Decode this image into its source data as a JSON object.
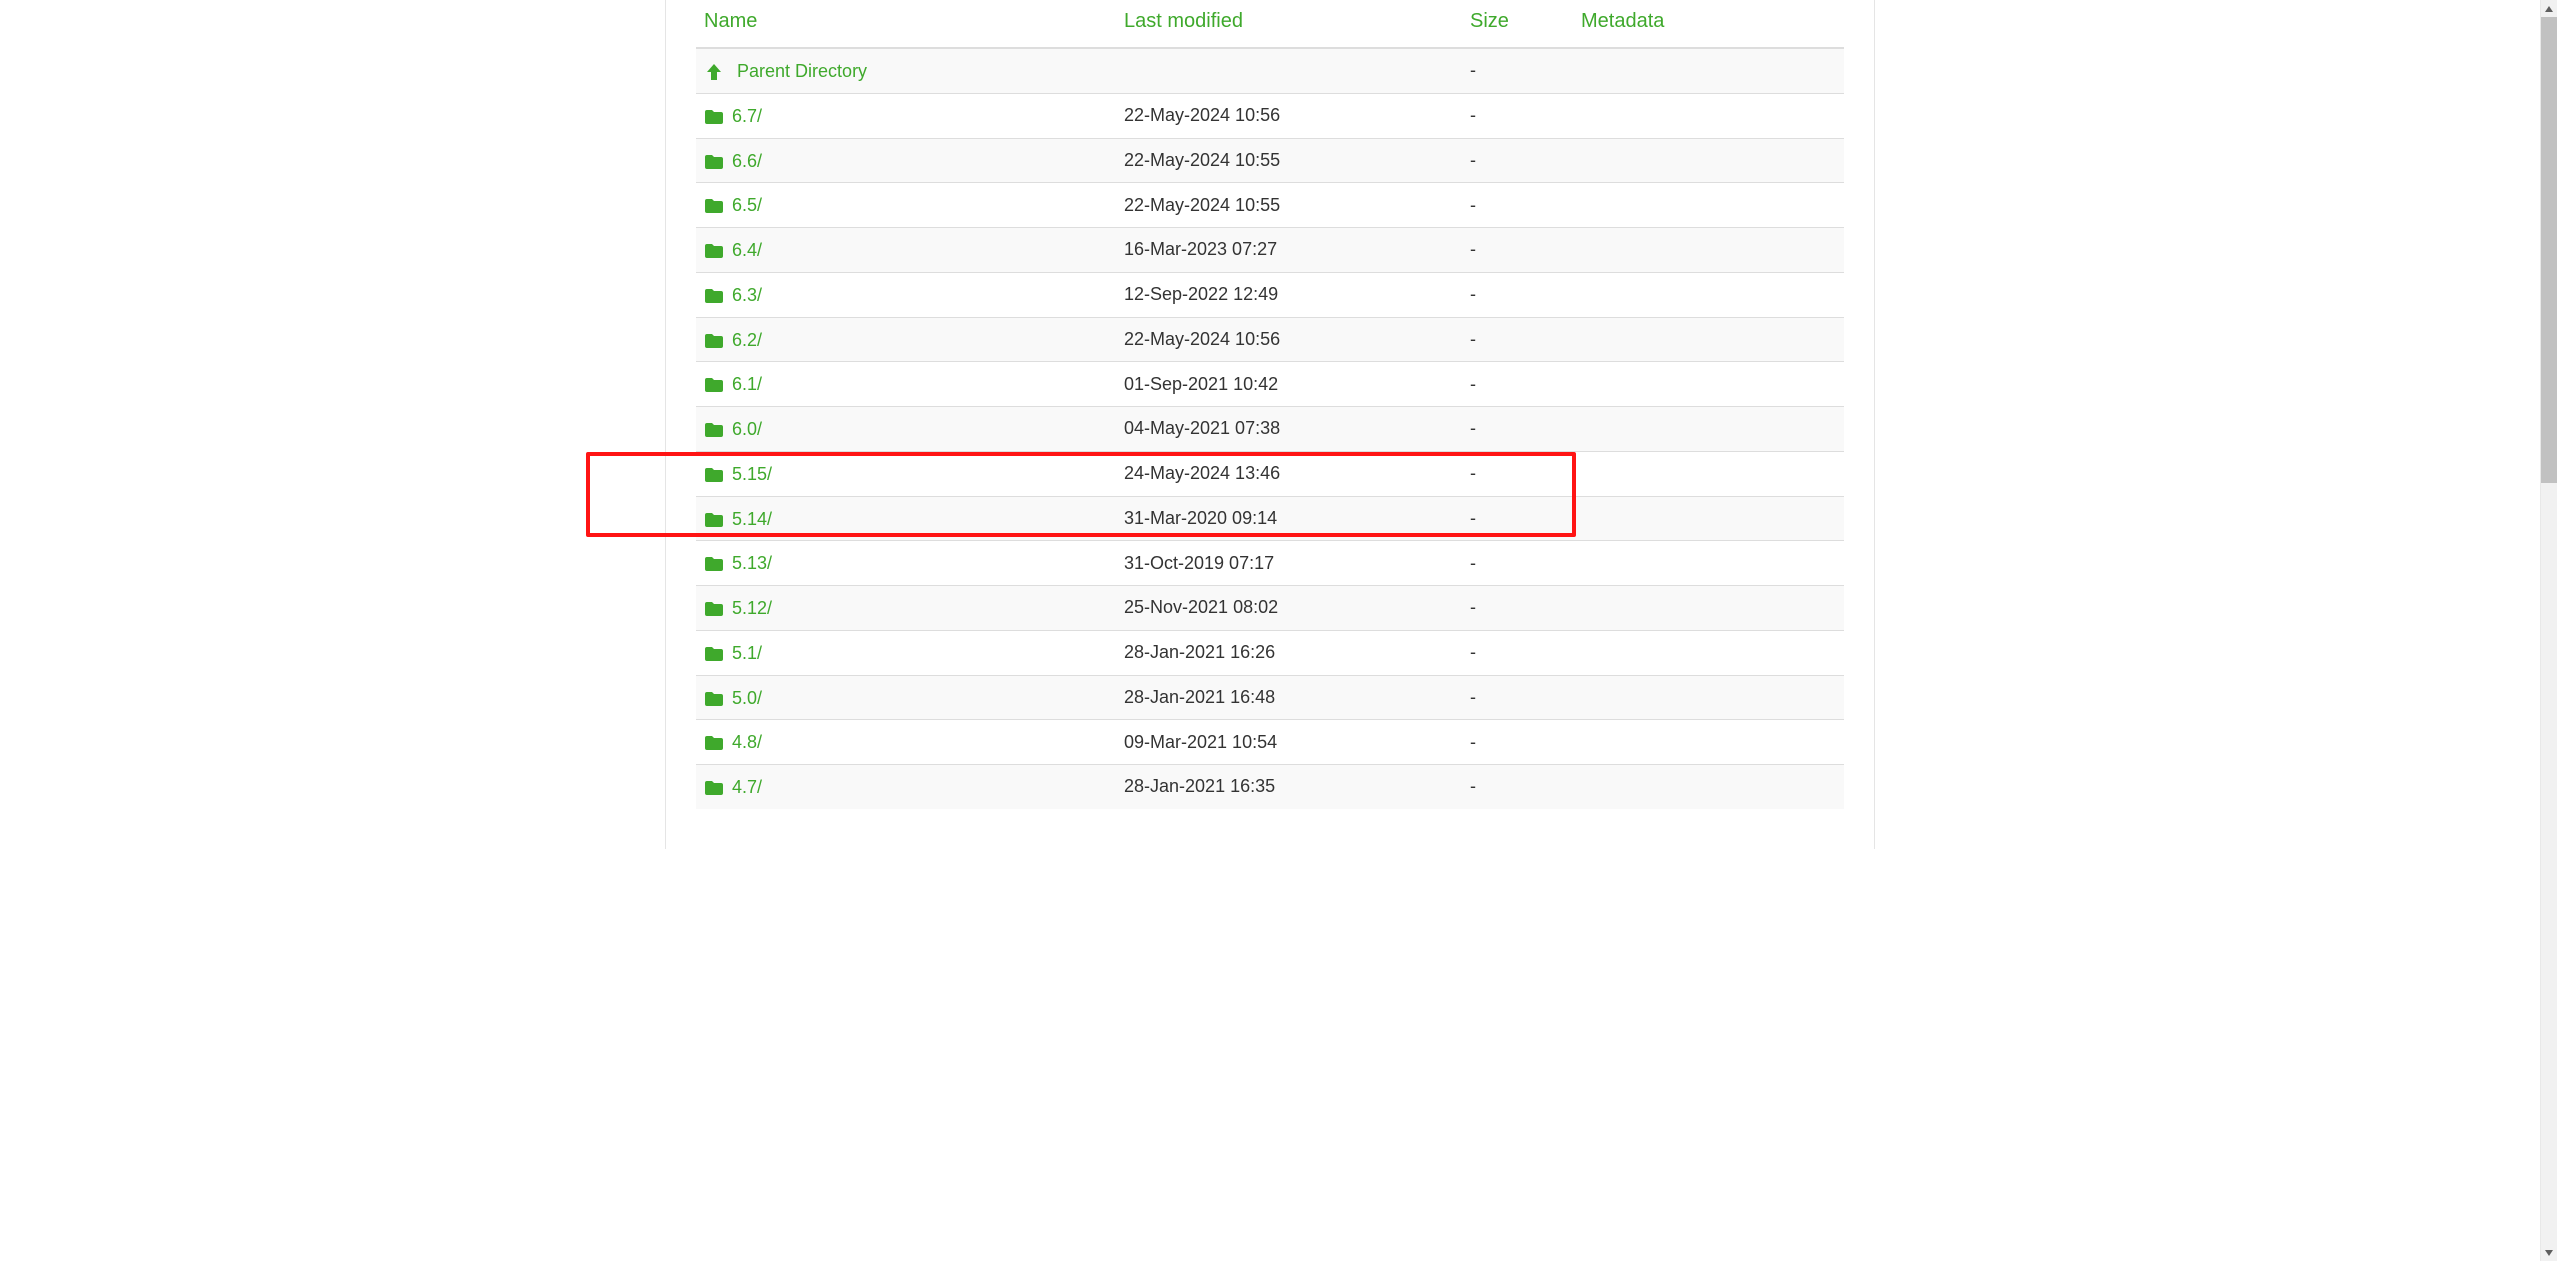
{
  "columns": {
    "name": "Name",
    "modified": "Last modified",
    "size": "Size",
    "metadata": "Metadata"
  },
  "parent": {
    "label": "Parent Directory",
    "size": "-"
  },
  "rows": [
    {
      "name": "6.7/",
      "modified": "22-May-2024 10:56",
      "size": "-",
      "metadata": ""
    },
    {
      "name": "6.6/",
      "modified": "22-May-2024 10:55",
      "size": "-",
      "metadata": ""
    },
    {
      "name": "6.5/",
      "modified": "22-May-2024 10:55",
      "size": "-",
      "metadata": ""
    },
    {
      "name": "6.4/",
      "modified": "16-Mar-2023 07:27",
      "size": "-",
      "metadata": ""
    },
    {
      "name": "6.3/",
      "modified": "12-Sep-2022 12:49",
      "size": "-",
      "metadata": ""
    },
    {
      "name": "6.2/",
      "modified": "22-May-2024 10:56",
      "size": "-",
      "metadata": ""
    },
    {
      "name": "6.1/",
      "modified": "01-Sep-2021 10:42",
      "size": "-",
      "metadata": ""
    },
    {
      "name": "6.0/",
      "modified": "04-May-2021 07:38",
      "size": "-",
      "metadata": ""
    },
    {
      "name": "5.15/",
      "modified": "24-May-2024 13:46",
      "size": "-",
      "metadata": ""
    },
    {
      "name": "5.14/",
      "modified": "31-Mar-2020 09:14",
      "size": "-",
      "metadata": ""
    },
    {
      "name": "5.13/",
      "modified": "31-Oct-2019 07:17",
      "size": "-",
      "metadata": ""
    },
    {
      "name": "5.12/",
      "modified": "25-Nov-2021 08:02",
      "size": "-",
      "metadata": ""
    },
    {
      "name": "5.1/",
      "modified": "28-Jan-2021 16:26",
      "size": "-",
      "metadata": ""
    },
    {
      "name": "5.0/",
      "modified": "28-Jan-2021 16:48",
      "size": "-",
      "metadata": ""
    },
    {
      "name": "4.8/",
      "modified": "09-Mar-2021 10:54",
      "size": "-",
      "metadata": ""
    },
    {
      "name": "4.7/",
      "modified": "28-Jan-2021 16:35",
      "size": "-",
      "metadata": ""
    }
  ],
  "highlight_row_index": 9
}
